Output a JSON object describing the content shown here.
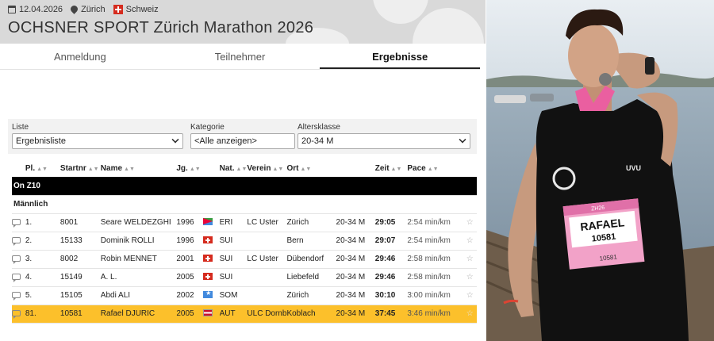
{
  "event": {
    "date": "12.04.2026",
    "city": "Zürich",
    "country": "Schweiz",
    "title": "OCHSNER SPORT Zürich Marathon 2026"
  },
  "tabs": [
    {
      "label": "Anmeldung",
      "active": false
    },
    {
      "label": "Teilnehmer",
      "active": false
    },
    {
      "label": "Ergebnisse",
      "active": true
    }
  ],
  "filters": {
    "list": {
      "label": "Liste",
      "value": "Ergebnisliste"
    },
    "category": {
      "label": "Kategorie",
      "value": "<Alle anzeigen>"
    },
    "age_class": {
      "label": "Altersklasse",
      "value": "20-34 M"
    }
  },
  "table": {
    "headers": {
      "place": "Pl.",
      "bib": "Startnr",
      "name": "Name",
      "year": "Jg.",
      "nat": "Nat.",
      "club": "Verein",
      "city": "Ort",
      "time": "Zeit",
      "pace": "Pace"
    },
    "group": "On Z10",
    "gender": "Männlich",
    "rows": [
      {
        "place": "1.",
        "bib": "8001",
        "name": "Seare WELDEZGHI",
        "year": "1996",
        "nat": "ERI",
        "club": "LC Uster",
        "city": "Zürich",
        "cat": "20-34 M",
        "time": "29:05",
        "pace": "2:54 min/km",
        "highlight": false
      },
      {
        "place": "2.",
        "bib": "15133",
        "name": "Dominik ROLLI",
        "year": "1996",
        "nat": "SUI",
        "club": "",
        "city": "Bern",
        "cat": "20-34 M",
        "time": "29:07",
        "pace": "2:54 min/km",
        "highlight": false
      },
      {
        "place": "3.",
        "bib": "8002",
        "name": "Robin MENNET",
        "year": "2001",
        "nat": "SUI",
        "club": "LC Uster",
        "city": "Dübendorf",
        "cat": "20-34 M",
        "time": "29:46",
        "pace": "2:58 min/km",
        "highlight": false
      },
      {
        "place": "4.",
        "bib": "15149",
        "name": "A. L.",
        "year": "2005",
        "nat": "SUI",
        "club": "",
        "city": "Liebefeld",
        "cat": "20-34 M",
        "time": "29:46",
        "pace": "2:58 min/km",
        "highlight": false
      },
      {
        "place": "5.",
        "bib": "15105",
        "name": "Abdi ALI",
        "year": "2002",
        "nat": "SOM",
        "club": "",
        "city": "Zürich",
        "cat": "20-34 M",
        "time": "30:10",
        "pace": "3:00 min/km",
        "highlight": false
      },
      {
        "place": "81.",
        "bib": "10581",
        "name": "Rafael DJURIC",
        "year": "2005",
        "nat": "AUT",
        "club": "ULC Dornb",
        "city": "Koblach",
        "cat": "20-34 M",
        "time": "37:45",
        "pace": "3:46 min/km",
        "highlight": true
      }
    ]
  },
  "photo": {
    "bib_name": "RAFAEL",
    "bib_number": "10581",
    "bib_small": "10581",
    "bib_brand": "ZH26",
    "shirt_logo": "UVU"
  },
  "colors": {
    "highlight": "#fcc02b",
    "header_bg": "#d9d9d9",
    "group_bg": "#000000",
    "bib_pink": "#f2a2c8"
  }
}
